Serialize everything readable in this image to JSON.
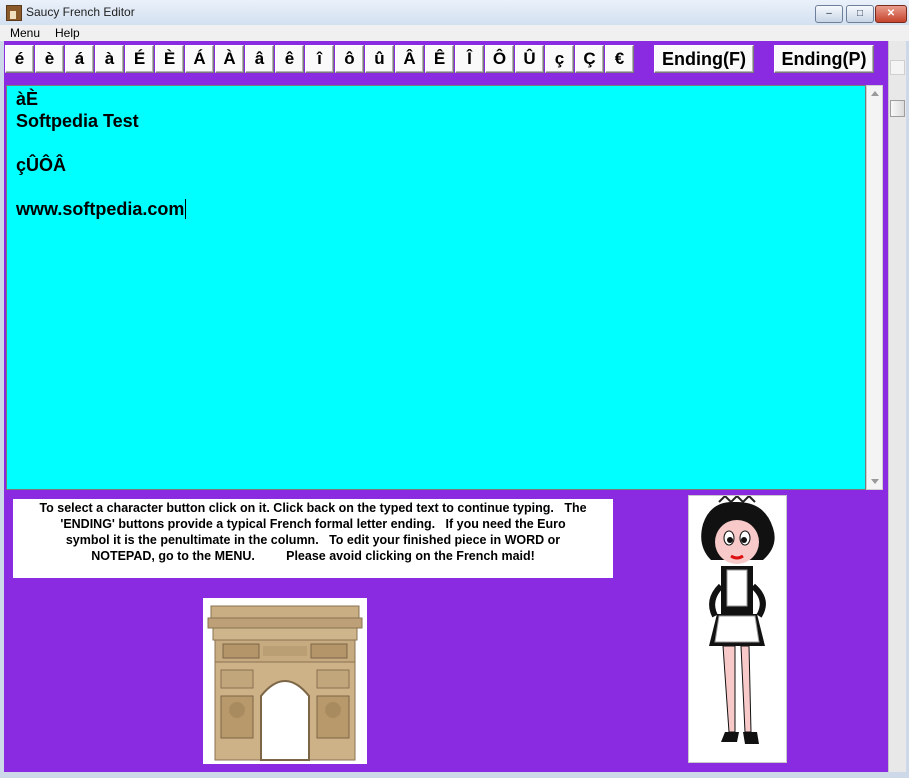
{
  "window": {
    "title": "Saucy French Editor",
    "controls": {
      "minimize": "–",
      "maximize": "□",
      "close": "✕"
    }
  },
  "menu": {
    "items": [
      "Menu",
      "Help"
    ]
  },
  "chars": [
    "é",
    "è",
    "á",
    "à",
    "É",
    "È",
    "Á",
    "À",
    "â",
    "ê",
    "î",
    "ô",
    "û",
    "Â",
    "Ê",
    "Î",
    "Ô",
    "Û",
    "ç",
    "Ç",
    "€"
  ],
  "endings": {
    "french": "Ending(F)",
    "p": "Ending(P)"
  },
  "editor": {
    "lines": [
      "àÈ",
      "Softpedia Test",
      "",
      "çÛÔÂ",
      "",
      "www.softpedia.com"
    ],
    "background": "#00ffff"
  },
  "help_lines": [
    "To select a character button click on it. Click back on the typed text to continue typing.   The",
    "'ENDING' buttons provide a typical French formal letter ending.   If you need the Euro",
    "symbol it is the penultimate in the column.   To edit your finished piece in WORD or",
    "NOTEPAD, go to the MENU.         Please avoid clicking on the French maid!"
  ],
  "colors": {
    "client": "#8a2be2",
    "editor": "#00ffff"
  }
}
